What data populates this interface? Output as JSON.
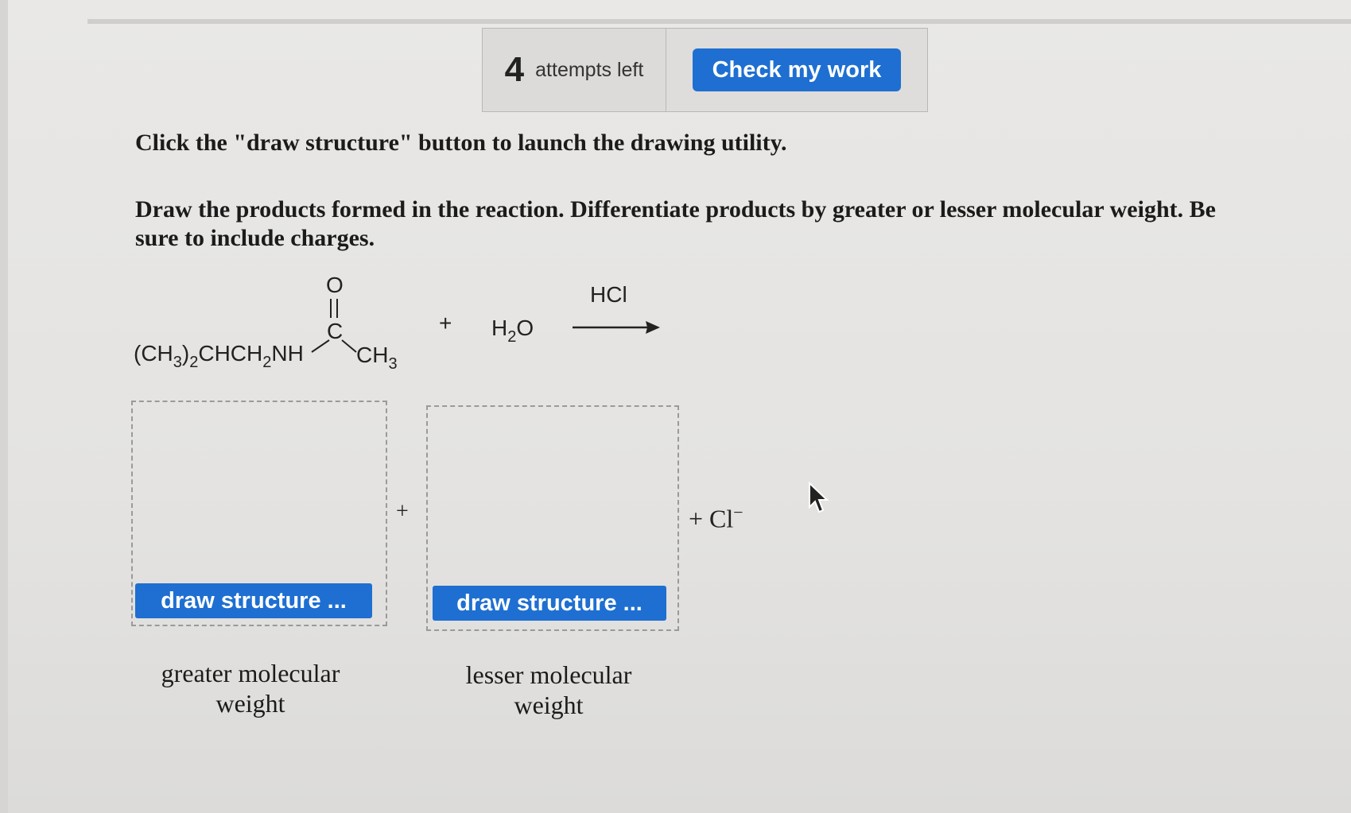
{
  "toolbar": {
    "attempts_count": "4",
    "attempts_label": "attempts left",
    "check_label": "Check my work"
  },
  "instructions": {
    "line1": "Click the \"draw structure\" button to launch the drawing utility.",
    "line2": "Draw the products formed in the reaction. Differentiate products by greater or lesser molecular weight. Be sure to include charges."
  },
  "reaction": {
    "carbonyl_oxygen": "O",
    "carbonyl_carbon": "C",
    "plus": "+",
    "reagent_label": "HCl"
  },
  "products": {
    "box1_button": "draw structure ...",
    "box2_button": "draw structure ...",
    "plus_between": "+",
    "extra_product_plus": "+",
    "extra_product": "Cl",
    "extra_product_charge": "−",
    "box1_caption_line1": "greater molecular",
    "box1_caption_line2": "weight",
    "box2_caption_line1": "lesser molecular",
    "box2_caption_line2": "weight"
  }
}
